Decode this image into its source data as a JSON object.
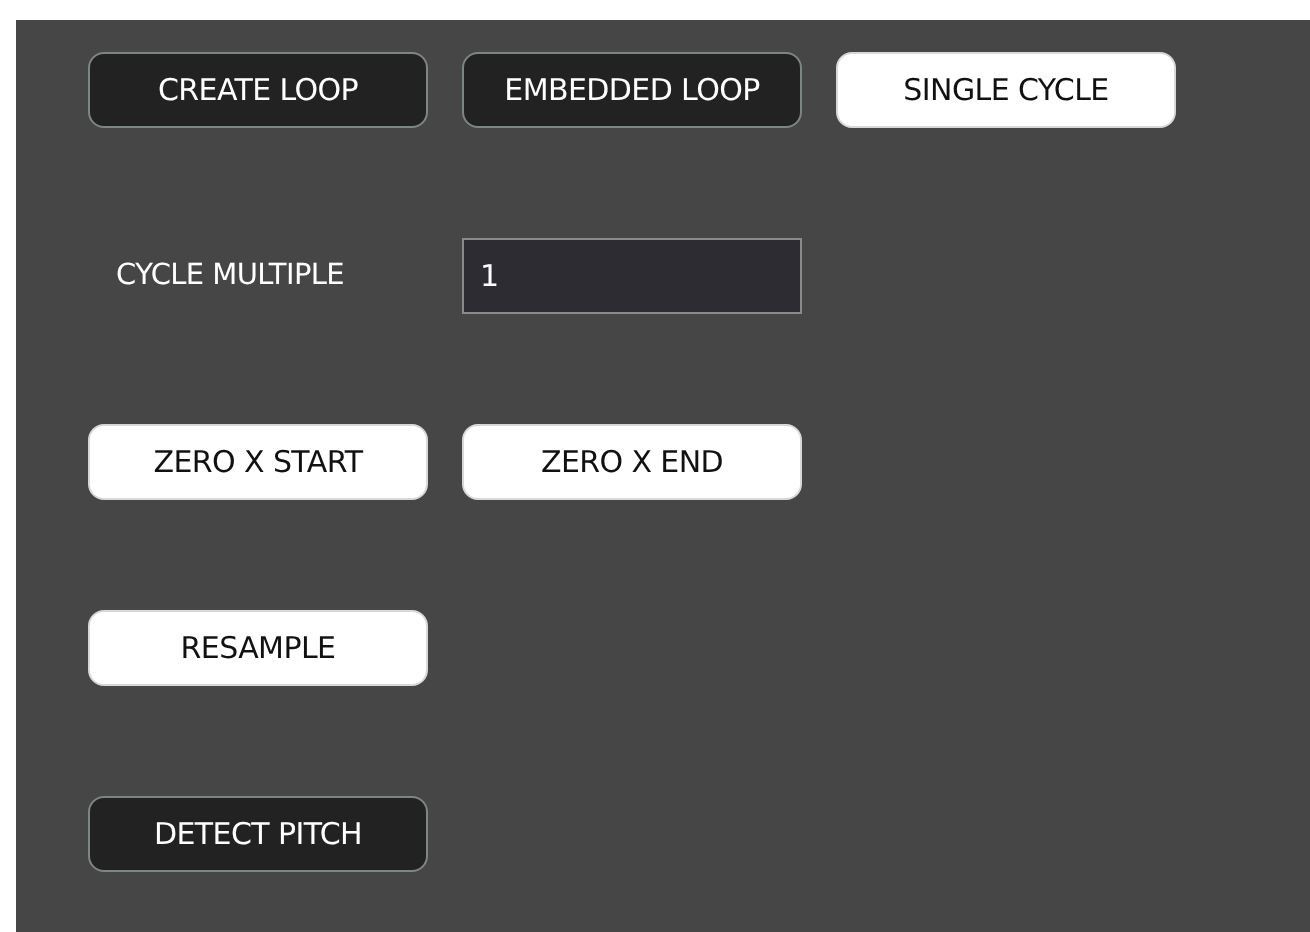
{
  "rows": [
    {
      "items": [
        {
          "kind": "button",
          "label": "CREATE LOOP",
          "selected": false
        },
        {
          "kind": "button",
          "label": "EMBEDDED LOOP",
          "selected": false
        },
        {
          "kind": "button",
          "label": "SINGLE CYCLE",
          "selected": true
        }
      ]
    },
    {
      "items": [
        {
          "kind": "field",
          "label": "CYCLE MULTIPLE",
          "value": "1"
        }
      ]
    },
    {
      "items": [
        {
          "kind": "button",
          "label": "ZERO X START",
          "selected": true
        },
        {
          "kind": "button",
          "label": "ZERO X END",
          "selected": true
        }
      ]
    },
    {
      "items": [
        {
          "kind": "button",
          "label": "RESAMPLE",
          "selected": true
        }
      ]
    },
    {
      "items": [
        {
          "kind": "button",
          "label": "DETECT PITCH",
          "selected": false
        }
      ]
    }
  ]
}
